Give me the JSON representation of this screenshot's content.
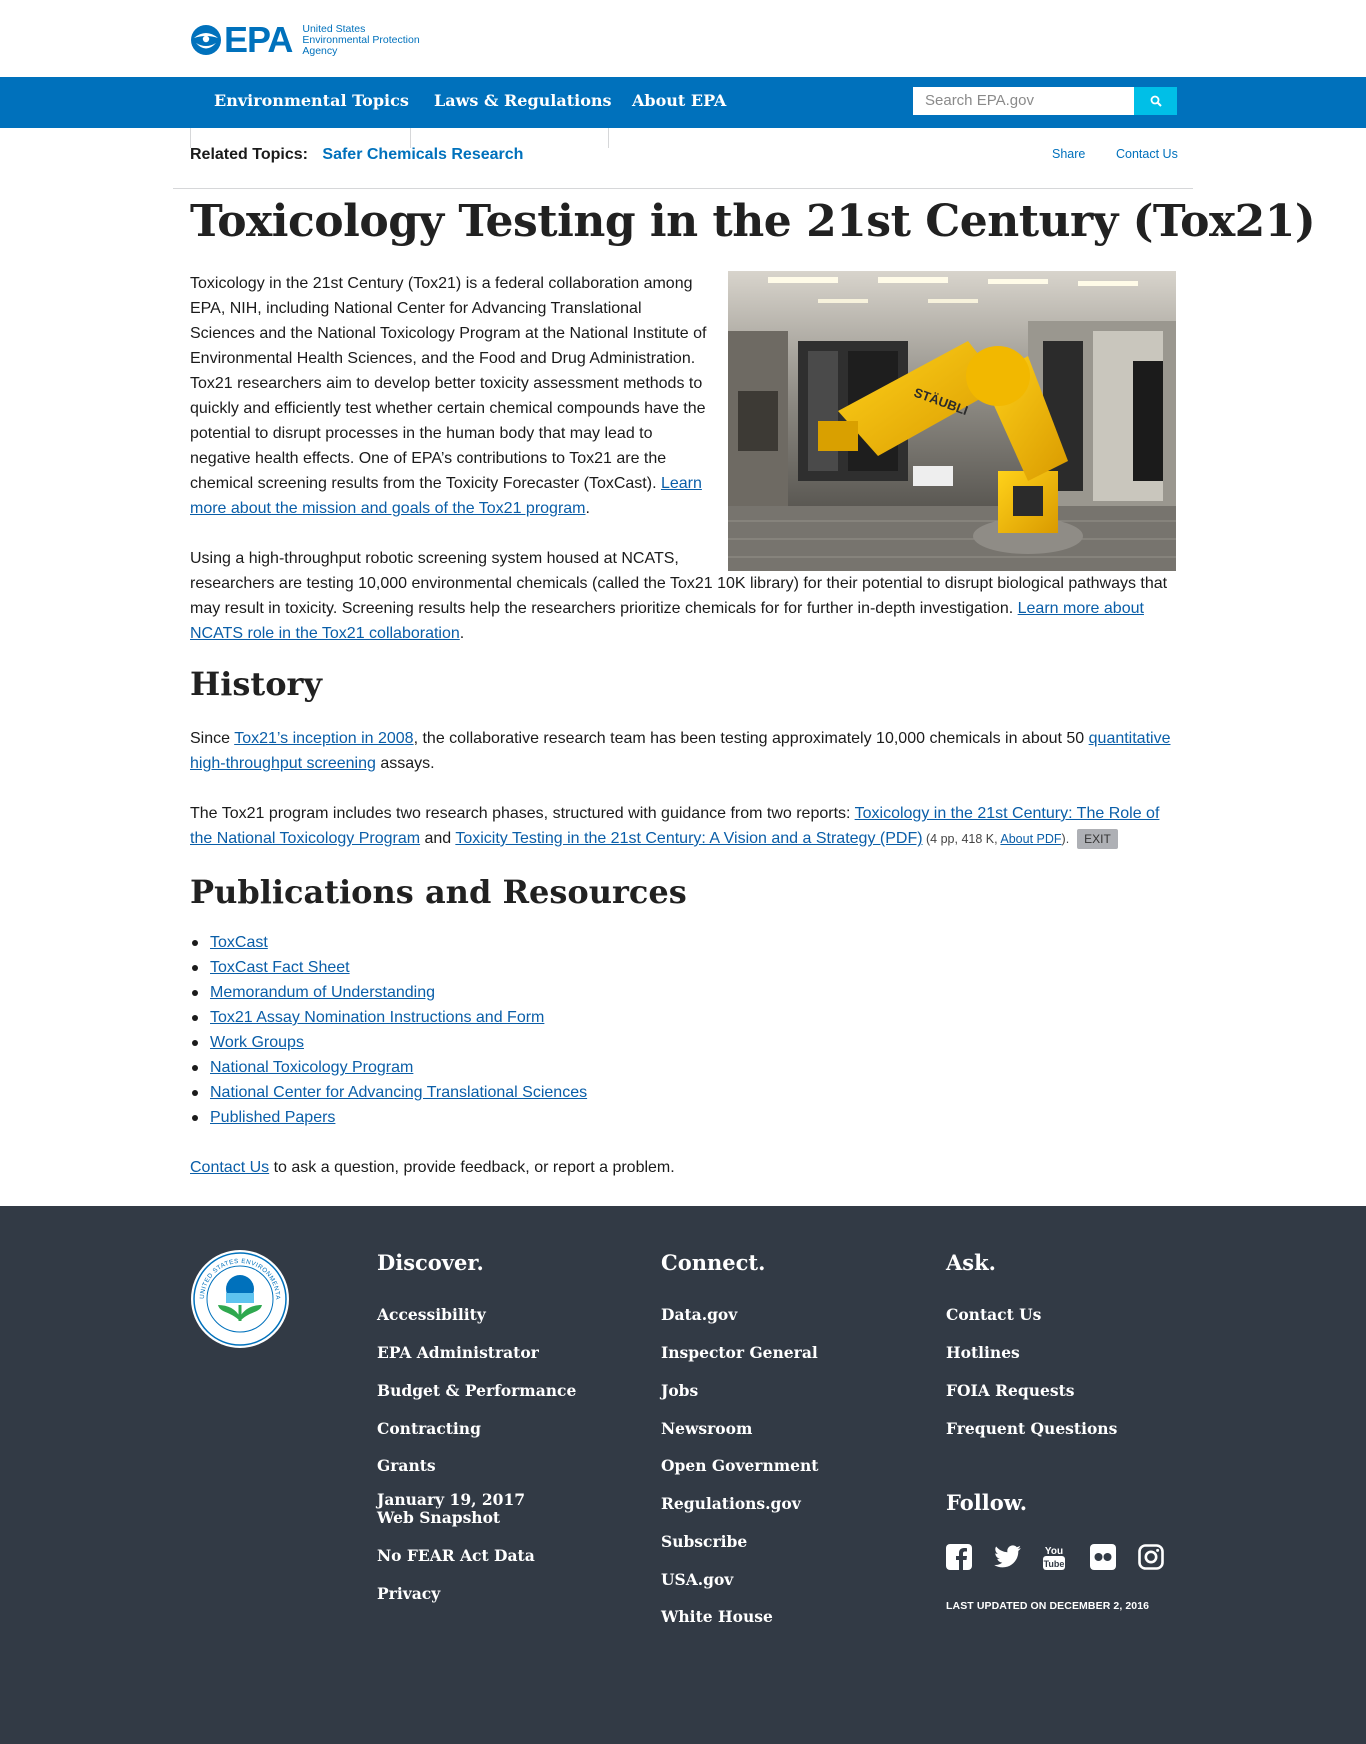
{
  "header": {
    "logo_text": "EPA",
    "agency_lines": [
      "United States",
      "Environmental Protection",
      "Agency"
    ]
  },
  "nav": {
    "items": [
      "Environmental Topics",
      "Laws & Regulations",
      "About EPA"
    ],
    "search_placeholder": "Search EPA.gov",
    "search_icon": "search-icon"
  },
  "related": {
    "label": "Related Topics:",
    "topic": "Safer Chemicals Research",
    "share": "Share",
    "contact": "Contact Us"
  },
  "page_title": "Toxicology Testing in the 21st Century (Tox21)",
  "intro": {
    "text": "Toxicology in the 21st Century (Tox21) is a federal collaboration among EPA, NIH, including National Center for Advancing Translational Sciences and the National Toxicology Program at the National Institute of Environmental Health Sciences, and the Food and Drug Administration. Tox21 researchers aim to develop better toxicity assessment methods to quickly and efficiently test whether certain chemical compounds have the potential to disrupt processes in the human body that may lead to negative health effects. One of EPA’s contributions to Tox21 are the chemical screening results from the Toxicity Forecaster (ToxCast). ",
    "link": "Learn more about the mission and goals of the Tox21 program",
    "end": "."
  },
  "robot_image_label": "STÄUBLI",
  "para2": {
    "text": "Using a high-throughput robotic screening system housed at NCATS, researchers are testing 10,000 environmental chemicals (called the Tox21 10K library) for their potential to disrupt biological pathways that may result in toxicity. Screening results help the researchers prioritize chemicals for for further in-depth investigation. ",
    "link": "Learn more about NCATS role in the Tox21 collaboration",
    "end": "."
  },
  "history": {
    "heading": "History",
    "p1_start": "Since ",
    "p1_link1": "Tox21’s inception in 2008",
    "p1_mid": ", the collaborative research team has been testing approximately 10,000 chemicals in about 50 ",
    "p1_link2": "quantitative high-throughput screening",
    "p1_end": " assays.",
    "p2_start": "The Tox21 program includes two research phases, structured with guidance from two reports: ",
    "p2_link1": "Toxicology in the 21st Century: The Role of the National Toxicology Program",
    "p2_and": " and ",
    "p2_link2": "Toxicity Testing in the 21st Century: A Vision and a Strategy (PDF)",
    "p2_meta_start": " (4 pp, 418 K, ",
    "p2_meta_link": "About PDF",
    "p2_meta_end": ").",
    "exit": "EXIT"
  },
  "publications": {
    "heading": "Publications and Resources",
    "items": [
      "ToxCast",
      "ToxCast Fact Sheet",
      "Memorandum of Understanding",
      "Tox21 Assay Nomination Instructions and Form",
      "Work Groups",
      "National Toxicology Program",
      "National Center for Advancing Translational Sciences",
      "Published Papers"
    ]
  },
  "contact_line": {
    "link": "Contact Us",
    "text": " to ask a question, provide feedback, or report a problem."
  },
  "footer": {
    "seal_text": "UNITED STATES ENVIRONMENTAL PROTECTION AGENCY",
    "discover": {
      "heading": "Discover.",
      "links": [
        "Accessibility",
        "EPA Administrator",
        "Budget & Performance",
        "Contracting",
        "Grants",
        "January 19, 2017 Web Snapshot",
        "No FEAR Act Data",
        "Privacy"
      ]
    },
    "connect": {
      "heading": "Connect.",
      "links": [
        "Data.gov",
        "Inspector General",
        "Jobs",
        "Newsroom",
        "Open Government",
        "Regulations.gov",
        "Subscribe",
        "USA.gov",
        "White House"
      ]
    },
    "ask": {
      "heading": "Ask.",
      "links": [
        "Contact Us",
        "Hotlines",
        "FOIA Requests",
        "Frequent Questions"
      ]
    },
    "follow": {
      "heading": "Follow.",
      "icons": [
        "facebook-icon",
        "twitter-icon",
        "youtube-icon",
        "flickr-icon",
        "instagram-icon"
      ]
    },
    "last_updated": "LAST UPDATED ON DECEMBER 2, 2016"
  },
  "colors": {
    "brand_blue": "#0071bc",
    "search_button": "#00bfe7",
    "footer_bg": "#323a45",
    "link": "#0a5ea8"
  }
}
